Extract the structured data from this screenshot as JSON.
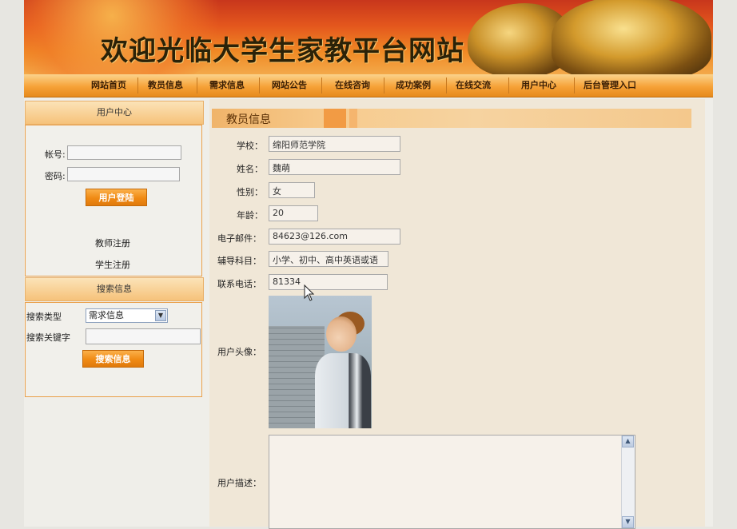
{
  "header": {
    "title": "欢迎光临大学生家教平台网站"
  },
  "nav": {
    "items": [
      "网站首页",
      "教员信息",
      "需求信息",
      "网站公告",
      "在线咨询",
      "成功案例",
      "在线交流",
      "用户中心",
      "后台管理入口"
    ]
  },
  "user_center": {
    "heading": "用户中心",
    "account_label": "帐号:",
    "account_value": "",
    "password_label": "密码:",
    "password_value": "",
    "login_button": "用户登陆",
    "teacher_register": "教师注册",
    "student_register": "学生注册"
  },
  "search": {
    "heading": "搜索信息",
    "type_label": "搜索类型",
    "type_selected": "需求信息",
    "keyword_label": "搜索关键字",
    "keyword_value": "",
    "button": "搜索信息"
  },
  "teacher_info": {
    "section_title": "教员信息",
    "fields": [
      {
        "label": "学校：",
        "value": "绵阳师范学院"
      },
      {
        "label": "姓名：",
        "value": "魏萌"
      },
      {
        "label": "性别：",
        "value": "女"
      },
      {
        "label": "年龄：",
        "value": "20"
      },
      {
        "label": "电子邮件：",
        "value": "84623@126.com"
      },
      {
        "label": "辅导科目：",
        "value": "小学、初中、高中英语或语"
      },
      {
        "label": "联系电话：",
        "value": "81334"
      }
    ],
    "avatar_label": "用户头像：",
    "description_label": "用户描述：",
    "description_value": ""
  },
  "icons": {
    "select_arrow": "chevron-down-icon",
    "scroll_up": "scroll-up-icon",
    "scroll_down": "scroll-down-icon",
    "cursor": "mouse-cursor-icon"
  },
  "colors": {
    "accent_orange": "#f08a14",
    "nav_gradient_top": "#fbd38c",
    "banner_red": "#c8361c"
  }
}
